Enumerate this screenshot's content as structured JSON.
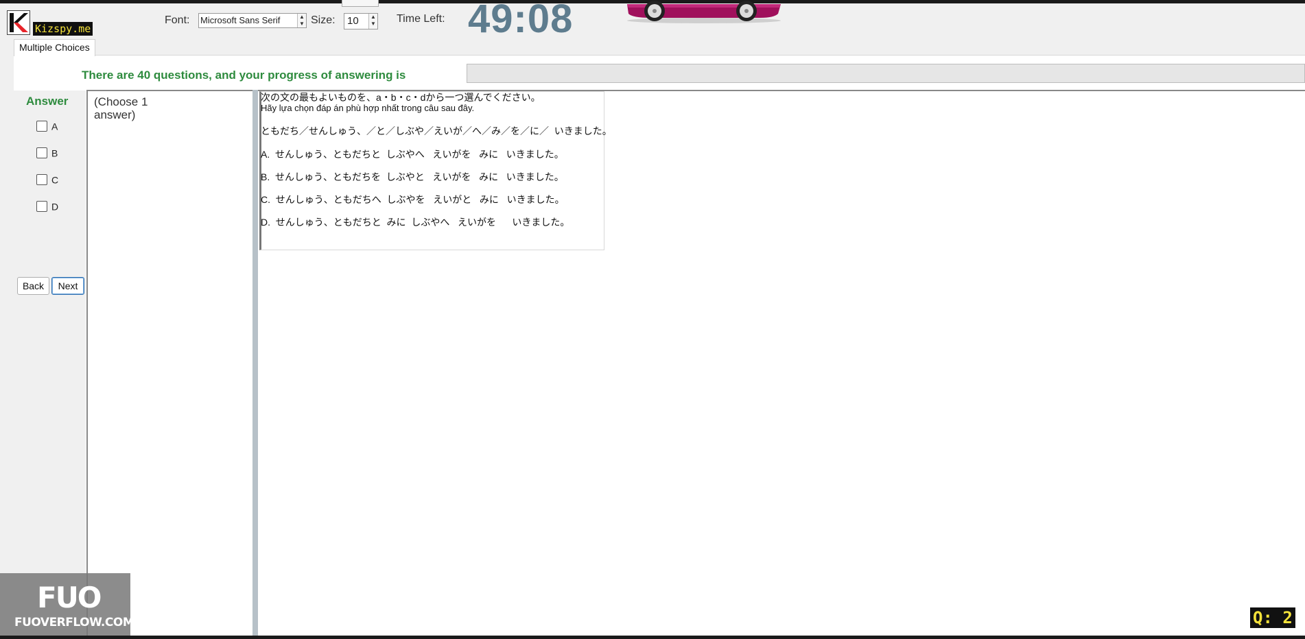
{
  "header": {
    "logo_text": "Kizspy.me",
    "font_label": "Font:",
    "font_value": "Microsoft Sans Serif",
    "size_label": "Size:",
    "size_value": "10",
    "time_left_label": "Time Left:",
    "timer": "49:08"
  },
  "tabs": [
    {
      "label": "Multiple Choices"
    }
  ],
  "progress": {
    "label": "There are 40 questions, and your progress of answering is",
    "value": 0
  },
  "answer_panel": {
    "title": "Answer",
    "options": [
      {
        "label": "A",
        "checked": false
      },
      {
        "label": "B",
        "checked": false
      },
      {
        "label": "C",
        "checked": false
      },
      {
        "label": "D",
        "checked": false
      }
    ],
    "back_label": "Back",
    "next_label": "Next"
  },
  "instruction": {
    "line1": "(Choose 1",
    "line2": "answer)"
  },
  "question": {
    "prompt_jp": "次の文の最もよいものを、a・b・c・dから一つ選んでください。",
    "prompt_vi": "Hãy lựa chọn đáp án phù hợp nhất trong câu sau đây.",
    "sentence": "ともだち／せんしゅう、／と／しぶや／えいが／へ／み／を／に／  いきました。",
    "choices": [
      "A.  せんしゅう、ともだちと  しぶやへ   えいがを   みに   いきました。",
      "B.  せんしゅう、ともだちを  しぶやと   えいがを   みに   いきました。",
      "C.  せんしゅう、ともだちへ  しぶやを   えいがと   みに   いきました。",
      "D.  せんしゅう、ともだちと  みに  しぶやへ   えいがを      いきました。"
    ]
  },
  "watermark": {
    "logo": "FUO",
    "site": "FUOVERFLOW.COM"
  },
  "question_counter": "Q: 2",
  "colors": {
    "accent_green": "#2e8b3e",
    "timer": "#5e7c8e",
    "badge_yellow": "#f4e23a"
  }
}
